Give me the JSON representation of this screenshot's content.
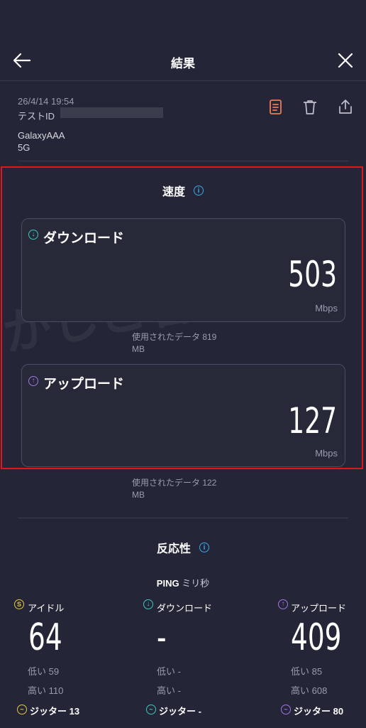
{
  "header": {
    "title": "結果"
  },
  "meta": {
    "timestamp": "26/4/14 19:54",
    "test_id_label": "テストID",
    "device": "GalaxyAAA",
    "network": "5G"
  },
  "speed": {
    "title": "速度",
    "download": {
      "label": "ダウンロード",
      "value": "503",
      "unit": "Mbps",
      "usage_line1": "使用されたデータ 819",
      "usage_line2": "MB"
    },
    "upload": {
      "label": "アップロード",
      "value": "127",
      "unit": "Mbps",
      "usage_line1": "使用されたデータ 122",
      "usage_line2": "MB"
    }
  },
  "responsiveness": {
    "title": "反応性",
    "ping_label": "PING",
    "ping_unit": "ミリ秒",
    "idle": {
      "label": "アイドル",
      "value": "64",
      "low": "低い 59",
      "high": "高い 110",
      "jitter_label": "ジッター",
      "jitter": "13"
    },
    "download": {
      "label": "ダウンロード",
      "value": "-",
      "low": "低い -",
      "high": "高い -",
      "jitter_label": "ジッター",
      "jitter": "-"
    },
    "upload": {
      "label": "アップロード",
      "value": "409",
      "low": "低い 85",
      "high": "高い 608",
      "jitter_label": "ジッター",
      "jitter": "80"
    }
  },
  "watermark": "かしこ暮らし",
  "colors": {
    "background": "#242637",
    "download_accent": "#3fc7c0",
    "upload_accent": "#a474e6",
    "idle_accent": "#e5c83c",
    "info": "#35a9e8",
    "highlight": "#e0161d",
    "report_icon": "#f07a55"
  }
}
